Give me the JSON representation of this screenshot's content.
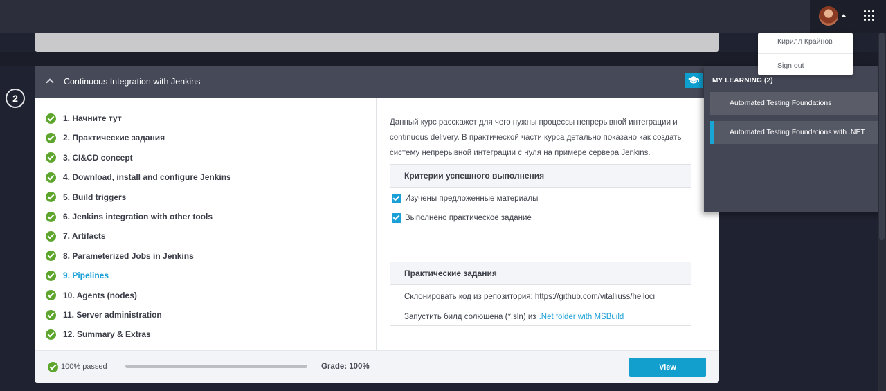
{
  "header": {
    "avatar_icon": "user-avatar",
    "apps_icon": "apps-grid-icon"
  },
  "user_menu": {
    "user_name": "Кирилл Крайнов",
    "sign_out": "Sign out"
  },
  "course": {
    "step_number": "2",
    "title": "Continuous Integration with Jenkins",
    "modules": [
      {
        "label": "1. Начните тут",
        "active": false
      },
      {
        "label": "2. Практические задания",
        "active": false
      },
      {
        "label": "3. CI&CD concept",
        "active": false
      },
      {
        "label": "4. Download, install and configure Jenkins",
        "active": false
      },
      {
        "label": "5. Build triggers",
        "active": false
      },
      {
        "label": "6. Jenkins integration with other tools",
        "active": false
      },
      {
        "label": "7. Artifacts",
        "active": false
      },
      {
        "label": "8. Parameterized Jobs in Jenkins",
        "active": false
      },
      {
        "label": "9. Pipelines",
        "active": true
      },
      {
        "label": "10. Agents (nodes)",
        "active": false
      },
      {
        "label": "11. Server administration",
        "active": false
      },
      {
        "label": "12. Summary & Extras",
        "active": false
      }
    ],
    "description": "Данный курс расскажет для чего нужны процессы непрерывной интеграции и continuous delivery. В практической части курса детально показано как создать систему непрерывной интеграции с нуля на примере сервера Jenkins.",
    "criteria": {
      "title": "Критерии успешного выполнения",
      "items": [
        "Изучены предложенные материалы",
        "Выполнено практическое задание"
      ]
    },
    "tasks": {
      "title": "Практические задания",
      "item1": "Склонировать код из репозитория: https://github.com/vitalliuss/helloci",
      "item2_prefix": "Запустить билд солюшена (*.sln) из",
      "item2_link": ".Net folder with MSBuild"
    },
    "footer": {
      "passed": "100% passed",
      "progress": 1.0,
      "grade": "Grade: 100%",
      "view_button": "View"
    }
  },
  "my_learning": {
    "title": "MY LEARNING (2)",
    "items": [
      {
        "label": "Automated Testing Foundations",
        "active": false
      },
      {
        "label": "Automated Testing Foundations with .NET",
        "active": true
      }
    ]
  },
  "colors": {
    "accent": "#1a9fd6",
    "success": "#5da52c",
    "header_bg": "#464958",
    "page_bg": "#1f2230"
  }
}
